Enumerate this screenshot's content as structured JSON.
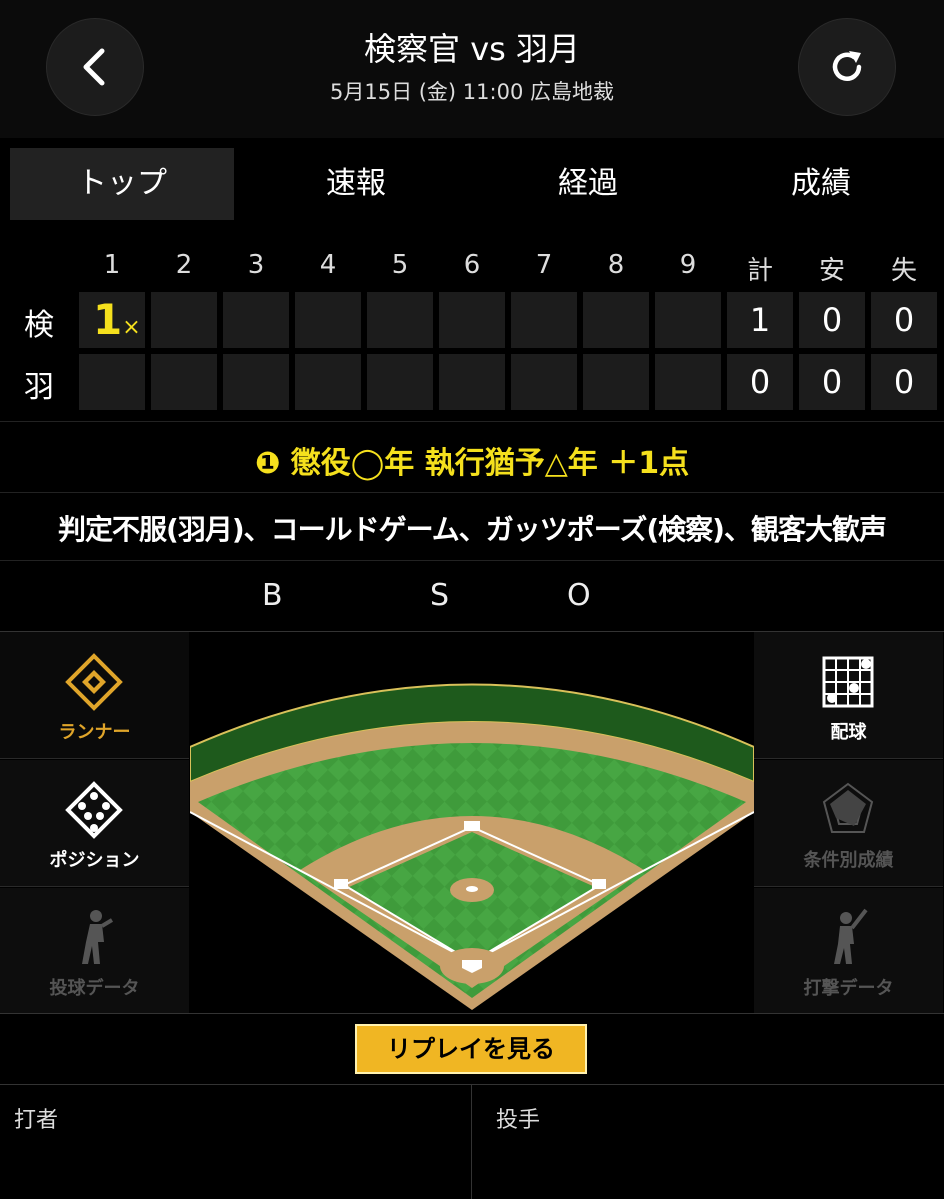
{
  "header": {
    "title": "検察官 vs 羽月",
    "subtitle": "5月15日 (金) 11:00  広島地裁",
    "back_icon": "chevron-left-icon",
    "refresh_icon": "refresh-icon"
  },
  "tabs": [
    {
      "label": "トップ",
      "active": true
    },
    {
      "label": "速報",
      "active": false
    },
    {
      "label": "経過",
      "active": false
    },
    {
      "label": "成績",
      "active": false
    }
  ],
  "scoreboard": {
    "headers": [
      "1",
      "2",
      "3",
      "4",
      "5",
      "6",
      "7",
      "8",
      "9",
      "計",
      "安",
      "失"
    ],
    "teams": [
      {
        "name": "検",
        "innings": [
          "1",
          "",
          "",
          "",
          "",
          "",
          "",
          "",
          ""
        ],
        "walkoff_mark": "×",
        "totals": [
          "1",
          "0",
          "0"
        ]
      },
      {
        "name": "羽",
        "innings": [
          "",
          "",
          "",
          "",
          "",
          "",
          "",
          "",
          ""
        ],
        "totals": [
          "0",
          "0",
          "0"
        ]
      }
    ]
  },
  "result": {
    "badge": "❶",
    "text": "懲役◯年 執行猶予△年 ＋1点"
  },
  "detail": "判定不服(羽月)、コールドゲーム、ガッツポーズ(検察)、観客大歓声",
  "count": {
    "b": "B",
    "s": "S",
    "o": "O"
  },
  "left_panel": [
    {
      "label": "ランナー",
      "icon": "runner-diamond-icon",
      "active": true
    },
    {
      "label": "ポジション",
      "icon": "position-diamond-icon",
      "active": false
    },
    {
      "label": "投球データ",
      "icon": "pitcher-silhouette-icon",
      "active": false
    }
  ],
  "right_panel": [
    {
      "label": "配球",
      "icon": "pitch-grid-icon",
      "active": false
    },
    {
      "label": "条件別成績",
      "icon": "radar-chart-icon",
      "active": false
    },
    {
      "label": "打撃データ",
      "icon": "batter-silhouette-icon",
      "active": false
    }
  ],
  "replay_button": "リプレイを見る",
  "batter_label": "打者",
  "pitcher_label": "投手",
  "colors": {
    "accent": "#f0b623",
    "score": "#f5e01d",
    "field_green": "#3f9b3b",
    "dirt": "#c9a06b"
  }
}
